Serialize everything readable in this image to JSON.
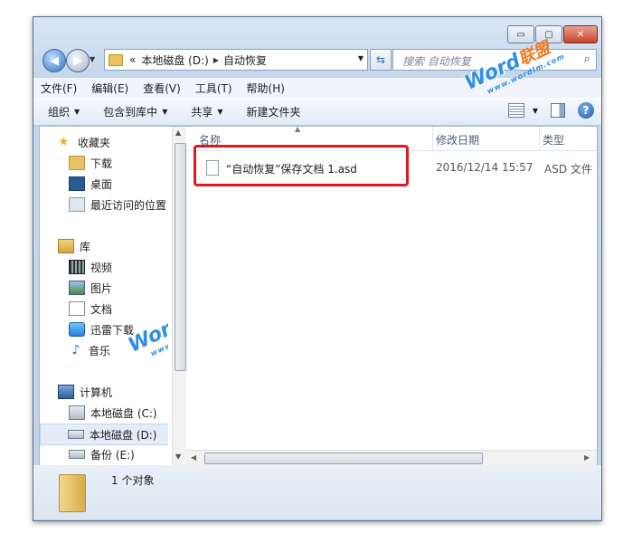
{
  "window": {
    "controls": {
      "minimize": "▭",
      "maximize": "▢",
      "close": "✕"
    }
  },
  "address": {
    "overflow": "«",
    "crumbs": [
      "本地磁盘 (D:)",
      "自动恢复"
    ]
  },
  "search": {
    "placeholder": "搜索 自动恢复"
  },
  "menu": [
    "文件(F)",
    "编辑(E)",
    "查看(V)",
    "工具(T)",
    "帮助(H)"
  ],
  "toolbar": {
    "organize": "组织",
    "include_library": "包含到库中",
    "share": "共享",
    "new_folder": "新建文件夹",
    "help": "?"
  },
  "nav": {
    "favorites": "收藏夹",
    "downloads": "下载",
    "desktop": "桌面",
    "recent": "最近访问的位置",
    "libraries": "库",
    "videos": "视频",
    "pictures": "图片",
    "documents": "文档",
    "thunder": "迅雷下载",
    "music": "音乐",
    "computer": "计算机",
    "drive_c": "本地磁盘 (C:)",
    "drive_d": "本地磁盘 (D:)",
    "drive_e": "备份 (E:)"
  },
  "columns": {
    "name": "名称",
    "modified": "修改日期",
    "type": "类型"
  },
  "files": [
    {
      "name": "“自动恢复”保存文档 1.asd",
      "modified": "2016/12/14 15:57",
      "type": "ASD 文件"
    }
  ],
  "status": {
    "count": "1 个对象"
  },
  "watermark": {
    "brand": "Word",
    "brand_cn": "联盟",
    "url": "www.wordlm.com"
  },
  "colors": {
    "highlight": "#e0191c",
    "accent": "#2f8fe6"
  }
}
